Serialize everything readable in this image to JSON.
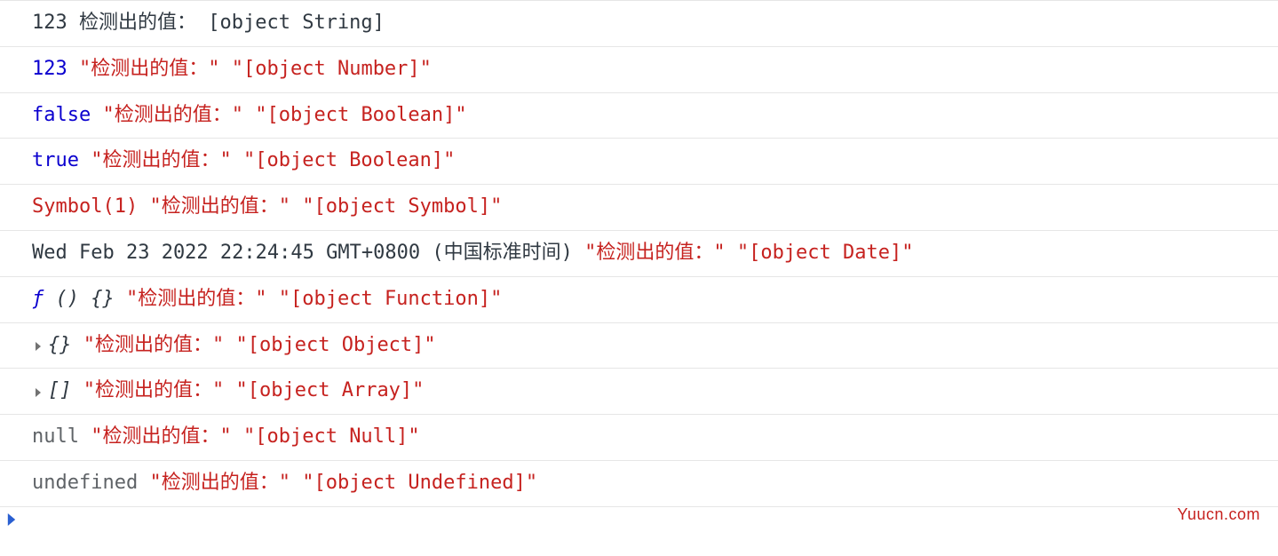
{
  "label": "\"检测出的值：\"",
  "label_plain": "检测出的值：",
  "rows": [
    {
      "kind": "plain-log",
      "parts": [
        {
          "text": "123 检测出的值： ",
          "cls": "tok-black"
        },
        {
          "text": "[object String]",
          "cls": "tok-black"
        }
      ]
    },
    {
      "kind": "multi",
      "parts": [
        {
          "text": "123",
          "cls": "tok-blue"
        },
        {
          "text": " ",
          "cls": "tok-black"
        },
        {
          "text": "\"检测出的值：\"",
          "cls": "tok-red"
        },
        {
          "text": " ",
          "cls": "tok-black"
        },
        {
          "text": "\"[object Number]\"",
          "cls": "tok-red"
        }
      ]
    },
    {
      "kind": "multi",
      "parts": [
        {
          "text": "false",
          "cls": "tok-blue"
        },
        {
          "text": " ",
          "cls": "tok-black"
        },
        {
          "text": "\"检测出的值：\"",
          "cls": "tok-red"
        },
        {
          "text": " ",
          "cls": "tok-black"
        },
        {
          "text": "\"[object Boolean]\"",
          "cls": "tok-red"
        }
      ]
    },
    {
      "kind": "multi",
      "parts": [
        {
          "text": "true",
          "cls": "tok-blue"
        },
        {
          "text": " ",
          "cls": "tok-black"
        },
        {
          "text": "\"检测出的值：\"",
          "cls": "tok-red"
        },
        {
          "text": " ",
          "cls": "tok-black"
        },
        {
          "text": "\"[object Boolean]\"",
          "cls": "tok-red"
        }
      ]
    },
    {
      "kind": "multi",
      "parts": [
        {
          "text": "Symbol(1)",
          "cls": "tok-red"
        },
        {
          "text": " ",
          "cls": "tok-black"
        },
        {
          "text": "\"检测出的值：\"",
          "cls": "tok-red"
        },
        {
          "text": " ",
          "cls": "tok-black"
        },
        {
          "text": "\"[object Symbol]\"",
          "cls": "tok-red"
        }
      ]
    },
    {
      "kind": "multi",
      "parts": [
        {
          "text": "Wed Feb 23 2022 22:24:45 GMT+0800 (中国标准时间)",
          "cls": "tok-black"
        },
        {
          "text": " ",
          "cls": "tok-black"
        },
        {
          "text": "\"检测出的值：\"",
          "cls": "tok-red"
        },
        {
          "text": " ",
          "cls": "tok-black"
        },
        {
          "text": "\"[object Date]\"",
          "cls": "tok-red"
        }
      ]
    },
    {
      "kind": "multi",
      "parts": [
        {
          "text": "ƒ",
          "cls": "tok-fn"
        },
        {
          "text": " () {}",
          "cls": "tok-black",
          "italic": true
        },
        {
          "text": " ",
          "cls": "tok-black"
        },
        {
          "text": "\"检测出的值：\"",
          "cls": "tok-red"
        },
        {
          "text": " ",
          "cls": "tok-black"
        },
        {
          "text": "\"[object Function]\"",
          "cls": "tok-red"
        }
      ]
    },
    {
      "kind": "expandable",
      "parts": [
        {
          "expand": true
        },
        {
          "text": "{}",
          "cls": "tok-black",
          "italic": true
        },
        {
          "text": " ",
          "cls": "tok-black"
        },
        {
          "text": "\"检测出的值：\"",
          "cls": "tok-red"
        },
        {
          "text": " ",
          "cls": "tok-black"
        },
        {
          "text": "\"[object Object]\"",
          "cls": "tok-red"
        }
      ]
    },
    {
      "kind": "expandable",
      "parts": [
        {
          "expand": true
        },
        {
          "text": "[]",
          "cls": "tok-black",
          "italic": true
        },
        {
          "text": " ",
          "cls": "tok-black"
        },
        {
          "text": "\"检测出的值：\"",
          "cls": "tok-red"
        },
        {
          "text": " ",
          "cls": "tok-black"
        },
        {
          "text": "\"[object Array]\"",
          "cls": "tok-red"
        }
      ]
    },
    {
      "kind": "multi",
      "parts": [
        {
          "text": "null",
          "cls": "tok-gray"
        },
        {
          "text": " ",
          "cls": "tok-black"
        },
        {
          "text": "\"检测出的值：\"",
          "cls": "tok-red"
        },
        {
          "text": " ",
          "cls": "tok-black"
        },
        {
          "text": "\"[object Null]\"",
          "cls": "tok-red"
        }
      ]
    },
    {
      "kind": "multi",
      "parts": [
        {
          "text": "undefined",
          "cls": "tok-gray"
        },
        {
          "text": " ",
          "cls": "tok-black"
        },
        {
          "text": "\"检测出的值：\"",
          "cls": "tok-red"
        },
        {
          "text": " ",
          "cls": "tok-black"
        },
        {
          "text": "\"[object Undefined]\"",
          "cls": "tok-red"
        }
      ]
    }
  ],
  "input": {
    "value": ""
  },
  "watermark": "Yuucn.com"
}
